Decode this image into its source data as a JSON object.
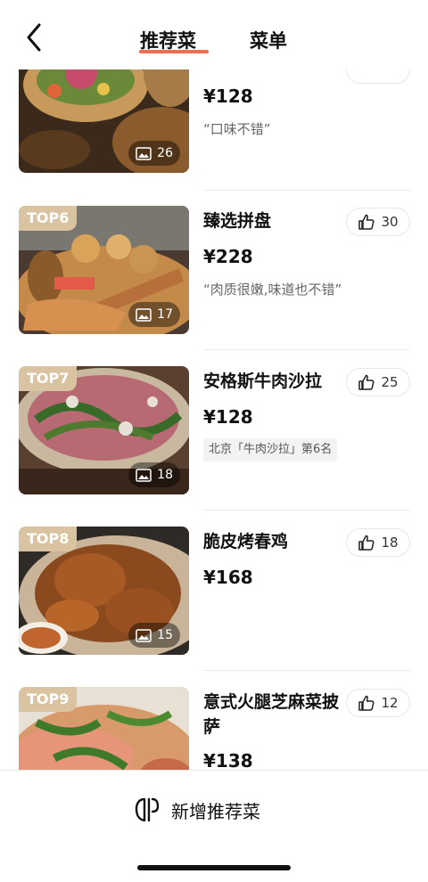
{
  "header": {
    "tabs": [
      {
        "label": "推荐菜",
        "active": true
      },
      {
        "label": "菜单",
        "active": false
      }
    ],
    "accent_color": "#f06d4f"
  },
  "items": [
    {
      "top": "",
      "name": "",
      "price": "¥128",
      "quote": "“口味不错”",
      "photos": "26",
      "likes": ""
    },
    {
      "top": "TOP6",
      "name": "臻选拼盘",
      "price": "¥228",
      "quote": "“肉质很嫩,味道也不错”",
      "photos": "17",
      "likes": "30"
    },
    {
      "top": "TOP7",
      "name": "安格斯牛肉沙拉",
      "price": "¥128",
      "rank_tag": "北京「牛肉沙拉」第6名",
      "photos": "18",
      "likes": "25"
    },
    {
      "top": "TOP8",
      "name": "脆皮烤春鸡",
      "price": "¥168",
      "photos": "15",
      "likes": "18"
    },
    {
      "top": "TOP9",
      "name": "意式火腿芝麻菜披萨",
      "price": "¥138",
      "photos": "",
      "likes": "12"
    }
  ],
  "bottom": {
    "add_label": "新增推荐菜"
  },
  "colors": {
    "badge": "#d9c3a0",
    "text": "#111111",
    "muted": "#666666"
  }
}
